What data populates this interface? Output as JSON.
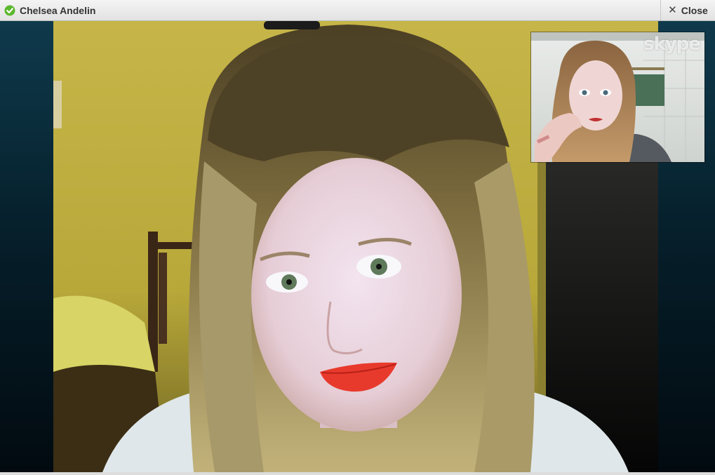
{
  "window": {
    "contact_name": "Chelsea Andelin",
    "close_label": "Close",
    "app_icon": "skype-status-icon",
    "close_icon": "close-x-icon"
  },
  "self_preview": {
    "watermark": "skype"
  },
  "colors": {
    "titlebar": "#e8e8e8",
    "call_background": "#06202c",
    "status_green": "#5cb82e"
  }
}
